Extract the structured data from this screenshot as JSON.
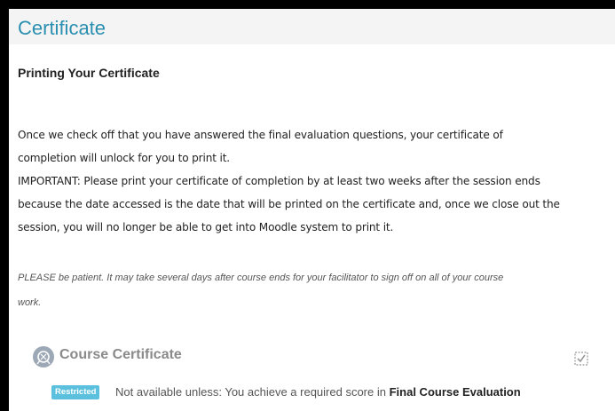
{
  "section": {
    "title": "Certificate"
  },
  "content": {
    "heading": "Printing Your Certificate",
    "paragraph_lines": [
      "Once we check off that you have answered the final evaluation questions, your certificate of",
      "completion will unlock for you to print it.",
      "IMPORTANT: Please print your certificate of completion by at least two weeks after the session ends",
      "because the date accessed is the date that will be printed on the certificate and, once we close out the",
      "session, you will no longer be able to get into Moodle system to print it."
    ],
    "note_lines": [
      "PLEASE be patient. It may take several days after course ends for your facilitator to sign off on all of your course",
      "work."
    ]
  },
  "activity": {
    "icon": "certificate-icon",
    "name": "Course Certificate",
    "completion_icon": "completion-checkbox-icon",
    "restriction": {
      "badge": "Restricted",
      "text": "Not available unless: You achieve a required score in",
      "target": "Final Course Evaluation"
    }
  },
  "colors": {
    "title": "#2a8fb0",
    "header_bg": "#f4f4f4",
    "badge_bg": "#5bc0de",
    "activity_link": "#8a8a8a"
  }
}
